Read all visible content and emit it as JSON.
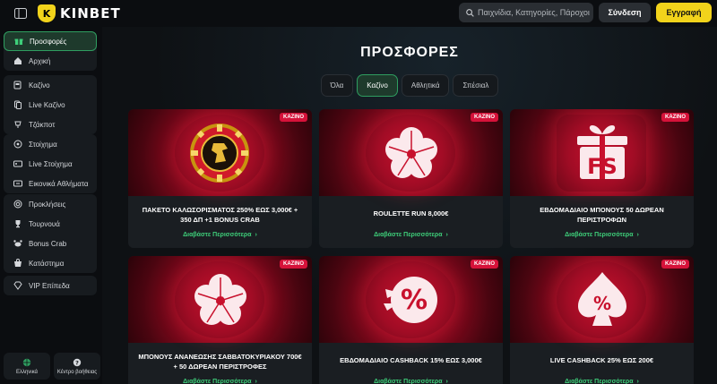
{
  "header": {
    "brand": "KINBET",
    "search_placeholder": "Παιχνίδια, Κατηγορίες, Πάροχοι",
    "login_label": "Σύνδεση",
    "register_label": "Εγγραφή"
  },
  "sidebar": {
    "group1": [
      {
        "label": "Προσφορές",
        "icon": "gift-icon"
      },
      {
        "label": "Αρχική",
        "icon": "home-icon"
      }
    ],
    "group2": [
      {
        "label": "Καζίνο",
        "icon": "slot-machine-icon"
      },
      {
        "label": "Live Καζίνο",
        "icon": "cards-icon"
      },
      {
        "label": "Τζάκποτ",
        "icon": "jackpot-icon"
      }
    ],
    "group3": [
      {
        "label": "Στοίχημα",
        "icon": "soccer-ball-icon"
      },
      {
        "label": "Live Στοίχημα",
        "icon": "live-icon"
      },
      {
        "label": "Εικονικά Αθλήματα",
        "icon": "virtual-sports-icon"
      }
    ],
    "group4": [
      {
        "label": "Προκλήσεις",
        "icon": "challenge-icon"
      },
      {
        "label": "Τουρνουά",
        "icon": "trophy-icon"
      },
      {
        "label": "Bonus Crab",
        "icon": "crab-icon"
      },
      {
        "label": "Κατάστημα",
        "icon": "shop-icon"
      }
    ],
    "group5": [
      {
        "label": "VIP Επίπεδα",
        "icon": "diamond-icon"
      }
    ],
    "footer": {
      "language": "Ελληνικά",
      "help": "Κέντρο βοήθειας"
    }
  },
  "main": {
    "title": "ΠΡΟΣΦΟΡΕΣ",
    "tabs": [
      "Όλα",
      "Καζίνο",
      "Αθλητικά",
      "Σπέσιαλ"
    ],
    "active_tab": "Καζίνο",
    "read_more": "Διαβάστε Περισσότερα",
    "cards": [
      {
        "badge": "ΚΑΖΙΝΟ",
        "title": "ΠΑΚΕΤΟ ΚΑΛΩΣΟΡΙΣΜΑΤΟΣ 250% ΕΩΣ 3,000€ + 350 ΔΠ +1 BONUS CRAB",
        "art": "golden-chip-icon"
      },
      {
        "badge": "ΚΑΖΙΝΟ",
        "title": "ROULETTE RUN 8,000€",
        "art": "clover-icon"
      },
      {
        "badge": "ΚΑΖΙΝΟ",
        "title": "ΕΒΔΟΜΑΔΙΑΙΟ ΜΠΟΝΟΥΣ 50 ΔΩΡΕΑΝ ΠΕΡΙΣΤΡΟΦΩΝ",
        "art": "fs-gift-icon"
      },
      {
        "badge": "ΚΑΖΙΝΟ",
        "title": "ΜΠΟΝΟΥΣ ΑΝΑΝΕΩΣΗΣ ΣΑΒΒΑΤΟΚΥΡΙΑΚΟΥ 700€ + 50 ΔΩΡΕΑΝ ΠΕΡΙΣΤΡΟΦΕΣ",
        "art": "clover-icon"
      },
      {
        "badge": "ΚΑΖΙΝΟ",
        "title": "ΕΒΔΟΜΑΔΙΑΙΟ CASHBACK 15% ΕΩΣ 3,000€",
        "art": "percent-icon"
      },
      {
        "badge": "ΚΑΖΙΝΟ",
        "title": "LIVE CASHBACK 25% ΕΩΣ 200€",
        "art": "spade-percent-icon"
      }
    ]
  },
  "colors": {
    "accent_green": "#3ecf7a",
    "brand_yellow": "#f2d31b",
    "badge_red": "#d6123a"
  }
}
